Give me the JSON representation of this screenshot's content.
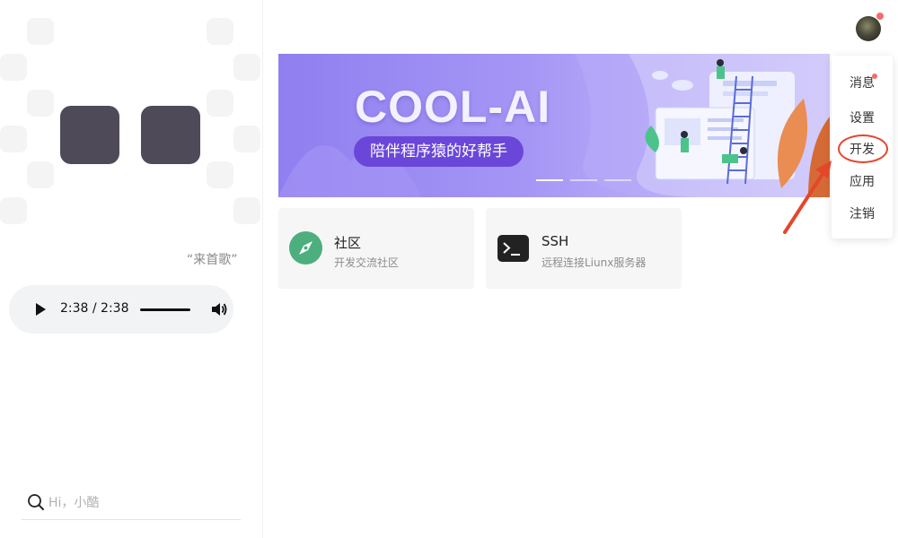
{
  "player": {
    "song_title": "“来首歌”",
    "time_display": "2:38 / 2:38",
    "progress": 1.0
  },
  "search": {
    "placeholder": "Hi，小酷",
    "value": ""
  },
  "banner": {
    "title": "COOL-AI",
    "subtitle": "陪伴程序猿的好帮手",
    "slides": 3,
    "active_slide": 0
  },
  "cards": [
    {
      "title": "社区",
      "desc": "开发交流社区",
      "icon": "compass-icon",
      "color": "#4caf7d"
    },
    {
      "title": "SSH",
      "desc": "远程连接Liunx服务器",
      "icon": "terminal-icon",
      "color": "#222222"
    }
  ],
  "user_menu": {
    "items": [
      {
        "label": "消息",
        "has_badge": true
      },
      {
        "label": "设置",
        "has_badge": false
      },
      {
        "label": "开发",
        "has_badge": false,
        "highlighted": true
      },
      {
        "label": "应用",
        "has_badge": false
      },
      {
        "label": "注销",
        "has_badge": false
      }
    ]
  },
  "colors": {
    "accent_purple": "#6a47d8",
    "badge_red": "#f36c6c",
    "annotation_red": "#e4462c"
  }
}
